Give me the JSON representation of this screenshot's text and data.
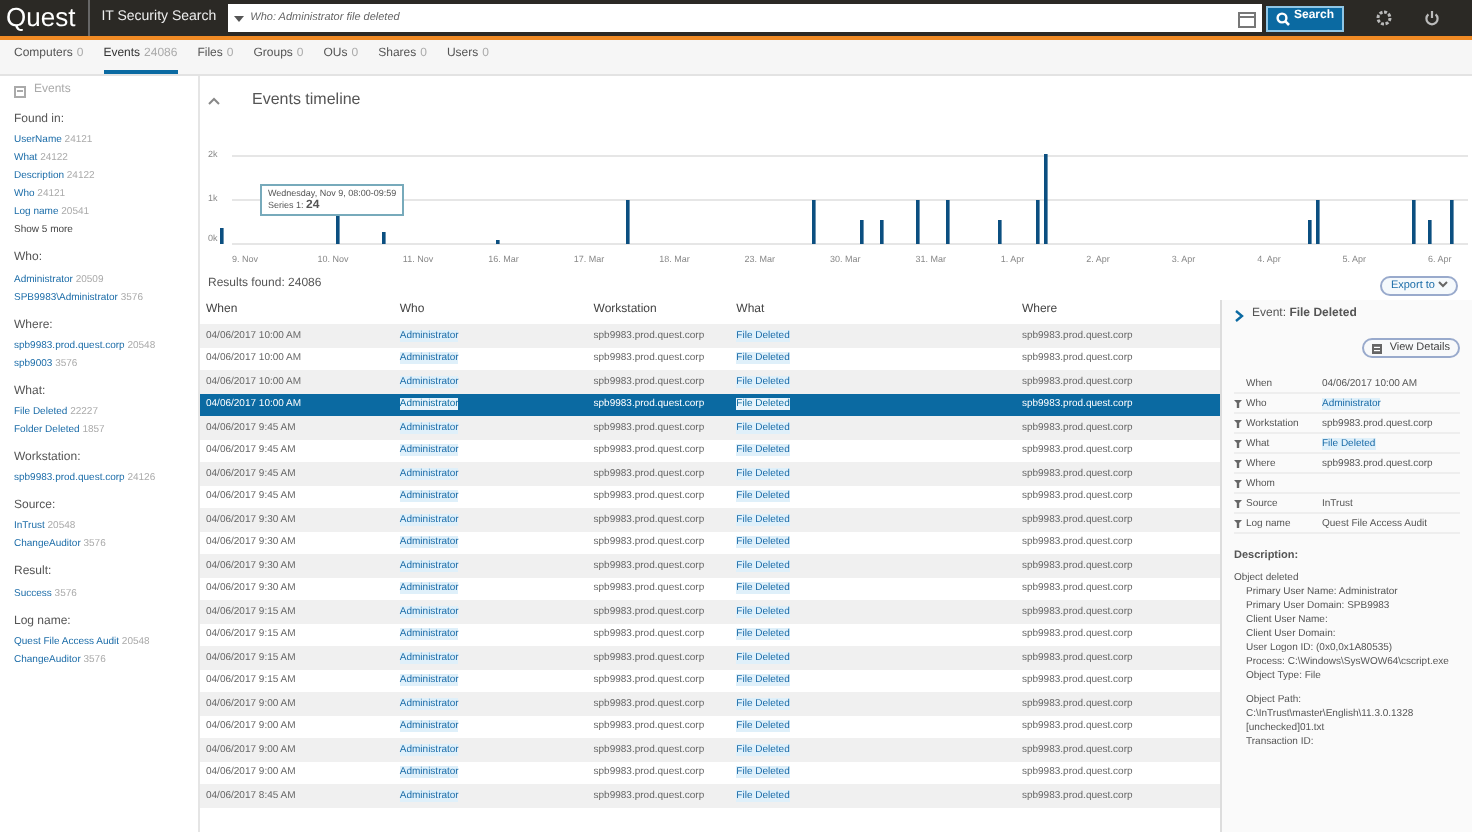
{
  "header": {
    "logo": "Quest",
    "app_title": "IT Security Search",
    "search": {
      "value": "Who: Administrator file deleted"
    },
    "search_button": "Search"
  },
  "tabs": [
    {
      "label": "Computers",
      "count": "0",
      "selected": false
    },
    {
      "label": "Events",
      "count": "24086",
      "selected": true
    },
    {
      "label": "Files",
      "count": "0",
      "selected": false
    },
    {
      "label": "Groups",
      "count": "0",
      "selected": false
    },
    {
      "label": "OUs",
      "count": "0",
      "selected": false
    },
    {
      "label": "Shares",
      "count": "0",
      "selected": false
    },
    {
      "label": "Users",
      "count": "0",
      "selected": false
    }
  ],
  "sidebar": {
    "breadcrumb": "Events",
    "groups": [
      {
        "title": "Found in:",
        "items": [
          {
            "label": "UserName",
            "count": "24121"
          },
          {
            "label": "What",
            "count": "24122"
          },
          {
            "label": "Description",
            "count": "24122"
          },
          {
            "label": "Who",
            "count": "24121"
          },
          {
            "label": "Log name",
            "count": "20541"
          }
        ],
        "more": "Show 5 more"
      },
      {
        "title": "Who:",
        "items": [
          {
            "label": "Administrator",
            "count": "20509"
          },
          {
            "label": "SPB9983\\Administrator",
            "count": "3576"
          }
        ]
      },
      {
        "title": "Where:",
        "items": [
          {
            "label": "spb9983.prod.quest.corp",
            "count": "20548"
          },
          {
            "label": "spb9003",
            "count": "3576"
          }
        ]
      },
      {
        "title": "What:",
        "items": [
          {
            "label": "File Deleted",
            "count": "22227"
          },
          {
            "label": "Folder Deleted",
            "count": "1857"
          }
        ]
      },
      {
        "title": "Workstation:",
        "items": [
          {
            "label": "spb9983.prod.quest.corp",
            "count": "24126"
          }
        ]
      },
      {
        "title": "Source:",
        "items": [
          {
            "label": "InTrust",
            "count": "20548"
          },
          {
            "label": "ChangeAuditor",
            "count": "3576"
          }
        ]
      },
      {
        "title": "Result:",
        "items": [
          {
            "label": "Success",
            "count": "3576"
          }
        ]
      },
      {
        "title": "Log name:",
        "items": [
          {
            "label": "Quest File Access Audit",
            "count": "20548"
          },
          {
            "label": "ChangeAuditor",
            "count": "3576"
          }
        ]
      }
    ]
  },
  "timeline": {
    "title": "Events timeline",
    "y_labels": [
      "2k",
      "1k",
      "0k"
    ],
    "x_labels": [
      "9. Nov",
      "10. Nov",
      "11. Nov",
      "16. Mar",
      "17. Mar",
      "18. Mar",
      "23. Mar",
      "30. Mar",
      "31. Mar",
      "1. Apr",
      "2. Apr",
      "3. Apr",
      "4. Apr",
      "5. Apr",
      "6. Apr"
    ],
    "tooltip": {
      "title": "Wednesday, Nov 9, 08:00-09:59",
      "series": "Series 1:",
      "value": "24"
    }
  },
  "results": {
    "label": "Results found: 24086",
    "export": "Export to"
  },
  "table": {
    "columns": [
      "When",
      "Who",
      "Workstation",
      "What",
      "Where"
    ],
    "rows": [
      {
        "when": "04/06/2017 10:00 AM",
        "who": "Administrator",
        "workstation": "spb9983.prod.quest.corp",
        "what": "File Deleted",
        "where": "spb9983.prod.quest.corp",
        "selected": false
      },
      {
        "when": "04/06/2017 10:00 AM",
        "who": "Administrator",
        "workstation": "spb9983.prod.quest.corp",
        "what": "File Deleted",
        "where": "spb9983.prod.quest.corp",
        "selected": false
      },
      {
        "when": "04/06/2017 10:00 AM",
        "who": "Administrator",
        "workstation": "spb9983.prod.quest.corp",
        "what": "File Deleted",
        "where": "spb9983.prod.quest.corp",
        "selected": false
      },
      {
        "when": "04/06/2017 10:00 AM",
        "who": "Administrator",
        "workstation": "spb9983.prod.quest.corp",
        "what": "File Deleted",
        "where": "spb9983.prod.quest.corp",
        "selected": true
      },
      {
        "when": "04/06/2017 9:45 AM",
        "who": "Administrator",
        "workstation": "spb9983.prod.quest.corp",
        "what": "File Deleted",
        "where": "spb9983.prod.quest.corp",
        "selected": false
      },
      {
        "when": "04/06/2017 9:45 AM",
        "who": "Administrator",
        "workstation": "spb9983.prod.quest.corp",
        "what": "File Deleted",
        "where": "spb9983.prod.quest.corp",
        "selected": false
      },
      {
        "when": "04/06/2017 9:45 AM",
        "who": "Administrator",
        "workstation": "spb9983.prod.quest.corp",
        "what": "File Deleted",
        "where": "spb9983.prod.quest.corp",
        "selected": false
      },
      {
        "when": "04/06/2017 9:45 AM",
        "who": "Administrator",
        "workstation": "spb9983.prod.quest.corp",
        "what": "File Deleted",
        "where": "spb9983.prod.quest.corp",
        "selected": false
      },
      {
        "when": "04/06/2017 9:30 AM",
        "who": "Administrator",
        "workstation": "spb9983.prod.quest.corp",
        "what": "File Deleted",
        "where": "spb9983.prod.quest.corp",
        "selected": false
      },
      {
        "when": "04/06/2017 9:30 AM",
        "who": "Administrator",
        "workstation": "spb9983.prod.quest.corp",
        "what": "File Deleted",
        "where": "spb9983.prod.quest.corp",
        "selected": false
      },
      {
        "when": "04/06/2017 9:30 AM",
        "who": "Administrator",
        "workstation": "spb9983.prod.quest.corp",
        "what": "File Deleted",
        "where": "spb9983.prod.quest.corp",
        "selected": false
      },
      {
        "when": "04/06/2017 9:30 AM",
        "who": "Administrator",
        "workstation": "spb9983.prod.quest.corp",
        "what": "File Deleted",
        "where": "spb9983.prod.quest.corp",
        "selected": false
      },
      {
        "when": "04/06/2017 9:15 AM",
        "who": "Administrator",
        "workstation": "spb9983.prod.quest.corp",
        "what": "File Deleted",
        "where": "spb9983.prod.quest.corp",
        "selected": false
      },
      {
        "when": "04/06/2017 9:15 AM",
        "who": "Administrator",
        "workstation": "spb9983.prod.quest.corp",
        "what": "File Deleted",
        "where": "spb9983.prod.quest.corp",
        "selected": false
      },
      {
        "when": "04/06/2017 9:15 AM",
        "who": "Administrator",
        "workstation": "spb9983.prod.quest.corp",
        "what": "File Deleted",
        "where": "spb9983.prod.quest.corp",
        "selected": false
      },
      {
        "when": "04/06/2017 9:15 AM",
        "who": "Administrator",
        "workstation": "spb9983.prod.quest.corp",
        "what": "File Deleted",
        "where": "spb9983.prod.quest.corp",
        "selected": false
      },
      {
        "when": "04/06/2017 9:00 AM",
        "who": "Administrator",
        "workstation": "spb9983.prod.quest.corp",
        "what": "File Deleted",
        "where": "spb9983.prod.quest.corp",
        "selected": false
      },
      {
        "when": "04/06/2017 9:00 AM",
        "who": "Administrator",
        "workstation": "spb9983.prod.quest.corp",
        "what": "File Deleted",
        "where": "spb9983.prod.quest.corp",
        "selected": false
      },
      {
        "when": "04/06/2017 9:00 AM",
        "who": "Administrator",
        "workstation": "spb9983.prod.quest.corp",
        "what": "File Deleted",
        "where": "spb9983.prod.quest.corp",
        "selected": false
      },
      {
        "when": "04/06/2017 9:00 AM",
        "who": "Administrator",
        "workstation": "spb9983.prod.quest.corp",
        "what": "File Deleted",
        "where": "spb9983.prod.quest.corp",
        "selected": false
      },
      {
        "when": "04/06/2017 8:45 AM",
        "who": "Administrator",
        "workstation": "spb9983.prod.quest.corp",
        "what": "File Deleted",
        "where": "spb9983.prod.quest.corp",
        "selected": false
      }
    ]
  },
  "details": {
    "title": "Event:",
    "event": "File Deleted",
    "view_button": "View Details",
    "fields": [
      {
        "label": "When",
        "value": "04/06/2017 10:00 AM",
        "filter": false
      },
      {
        "label": "Who",
        "value": "Administrator",
        "filter": true
      },
      {
        "label": "Workstation",
        "value": "spb9983.prod.quest.corp",
        "filter": true
      },
      {
        "label": "What",
        "value": "File Deleted",
        "filter": true
      },
      {
        "label": "Where",
        "value": "spb9983.prod.quest.corp",
        "filter": true
      },
      {
        "label": "Whom",
        "filter": true
      },
      {
        "label": "Source",
        "value": "InTrust",
        "filter": true
      },
      {
        "label": "Log name",
        "value": "Quest File Access Audit",
        "filter": true
      }
    ],
    "description_title": "Description:",
    "description": [
      {
        "kind": "head",
        "text": "Object deleted"
      },
      {
        "kind": "field",
        "text": "Primary User Name: Administrator"
      },
      {
        "kind": "field",
        "text": "Primary User Domain: SPB9983"
      },
      {
        "kind": "field",
        "text": "Client User Name:"
      },
      {
        "kind": "field",
        "text": "Client User Domain:"
      },
      {
        "kind": "field",
        "text": "User Logon ID: (0x0,0x1A80535)"
      },
      {
        "kind": "field",
        "text": "Process: C:\\Windows\\SysWOW64\\cscript.exe"
      },
      {
        "kind": "field",
        "text": "Object Type: File"
      },
      {
        "kind": "gap",
        "text": "Object Path: C:\\InTrust\\master\\English\\11.3.0.1328 [unchecked]01.txt"
      },
      {
        "kind": "field",
        "text": "Transaction ID:"
      }
    ]
  }
}
